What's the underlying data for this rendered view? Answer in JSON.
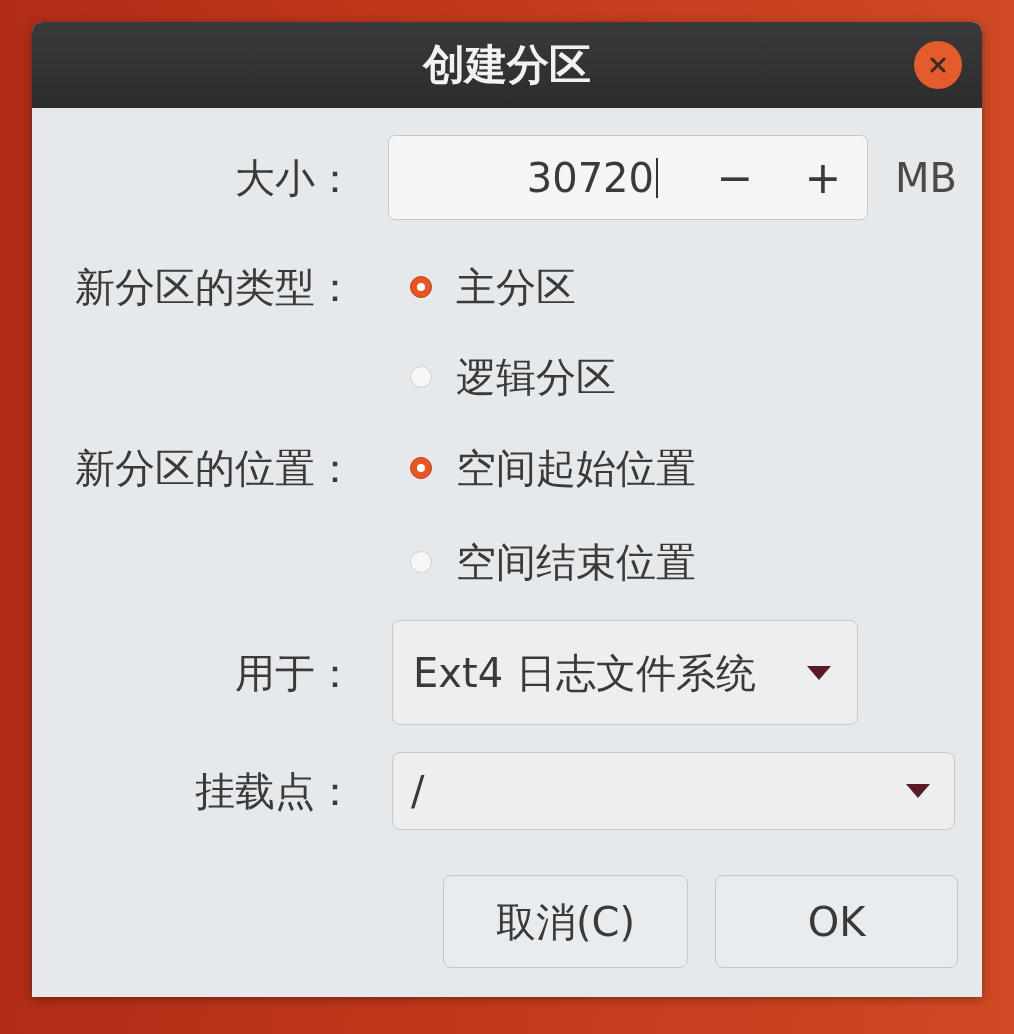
{
  "window": {
    "title": "创建分区"
  },
  "size": {
    "label": "大小：",
    "value": "30720",
    "decrement": "−",
    "increment": "+",
    "unit": "MB"
  },
  "partition_type": {
    "label": "新分区的类型：",
    "options": [
      {
        "label": "主分区",
        "selected": true
      },
      {
        "label": "逻辑分区",
        "selected": false
      }
    ]
  },
  "location": {
    "label": "新分区的位置：",
    "options": [
      {
        "label": "空间起始位置",
        "selected": true
      },
      {
        "label": "空间结束位置",
        "selected": false
      }
    ]
  },
  "use_as": {
    "label": "用于：",
    "value": "Ext4 日志文件系统"
  },
  "mount_point": {
    "label": "挂载点：",
    "value": "/"
  },
  "buttons": [
    {
      "label": "取消(C)"
    },
    {
      "label": "OK"
    }
  ]
}
